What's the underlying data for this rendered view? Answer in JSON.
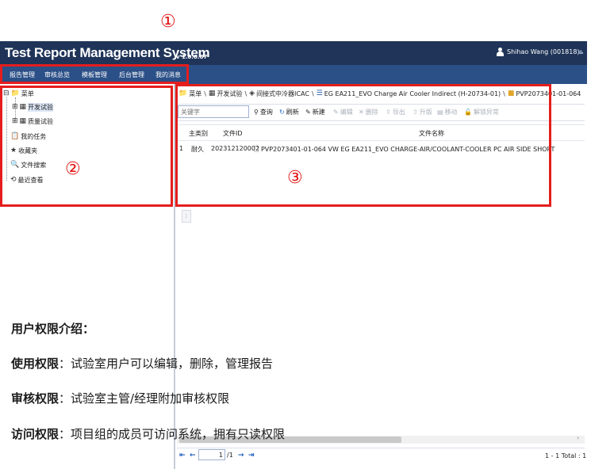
{
  "annotations": {
    "one": "①",
    "two": "②",
    "three": "③"
  },
  "header": {
    "title": "Test Report Management System",
    "version": "v 1.0.0.87",
    "user": "Shihao Wang (001818)",
    "logout_glyph": "⏏"
  },
  "nav": {
    "items": [
      "报告管理",
      "审核总览",
      "模板管理",
      "后台管理",
      "我的消息"
    ]
  },
  "tree": {
    "root": "菜单",
    "dev_test": "开发试验",
    "quality_test": "质量试验",
    "my_tasks": "我的任务",
    "favorites": "收藏夹",
    "file_search": "文件搜索",
    "recent": "最近查看"
  },
  "breadcrumb": {
    "items": [
      "菜单",
      "开发试验",
      "间接式中冷器ICAC",
      "EG EA211_EVO Charge Air Cooler Indirect (H-20734-01)",
      "PVP2073401-01-064"
    ],
    "separator": "\\"
  },
  "toolbar": {
    "search_placeholder": "关键字",
    "query": "查询",
    "refresh": "刷新",
    "new": "新建",
    "edit": "编辑",
    "delete": "删除",
    "export": "导出",
    "upgrade": "升版",
    "move": "移动",
    "unlock": "解锁异常"
  },
  "table": {
    "headers": {
      "main_type": "主类别",
      "file_id": "文件ID",
      "file_name": "文件名称"
    },
    "rows": [
      {
        "index": "1",
        "main_type": "耐久",
        "file_id": "202312120002",
        "file_name": "PVP2073401-01-064 VW EG EA211_EVO CHARGE-AIR/COOLANT-COOLER PC AIR SIDE SHORT"
      }
    ]
  },
  "pager": {
    "page": "1",
    "total_pages": "/1",
    "summary": "1 - 1 Total : 1"
  },
  "overlay": {
    "heading": "用户权限介绍：",
    "line1_label": "使用权限",
    "line1_text": "：试验室用户可以编辑，删除，管理报告",
    "line2_label": "审核权限",
    "line2_text": "：试验室主管/经理附加审核权限",
    "line3_label": "访问权限",
    "line3_text": "：项目组的成员可访问系统，拥有只读权限"
  }
}
